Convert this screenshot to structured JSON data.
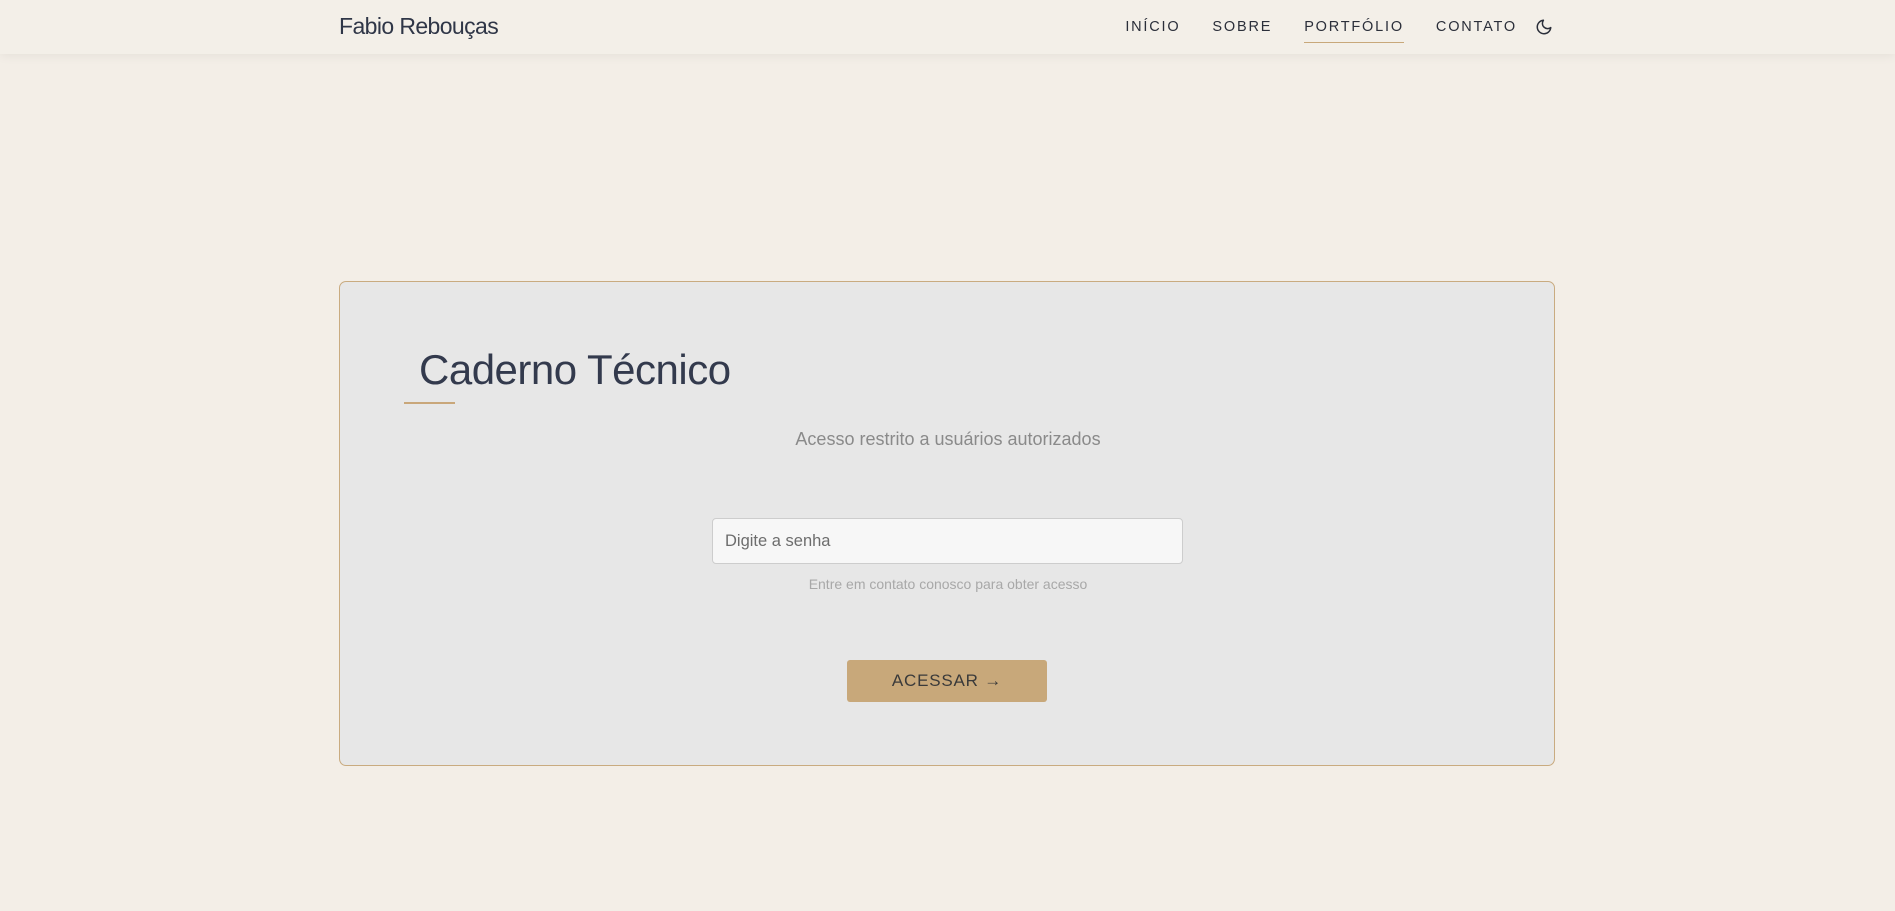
{
  "header": {
    "brand": "Fabio Rebouças",
    "nav": [
      {
        "label": "INÍCIO",
        "active": false
      },
      {
        "label": "SOBRE",
        "active": false
      },
      {
        "label": "PORTFÓLIO",
        "active": true
      },
      {
        "label": "CONTATO",
        "active": false
      }
    ],
    "theme_toggle_icon": "moon-icon"
  },
  "card": {
    "title": "Caderno Técnico",
    "subtitle": "Acesso restrito a usuários autorizados",
    "password": {
      "placeholder": "Digite a senha",
      "value": ""
    },
    "hint": "Entre em contato conosco para obter acesso",
    "button_label": "ACESSAR →"
  },
  "colors": {
    "background": "#f3eee7",
    "card_background": "#e7e7e7",
    "accent": "#c8a87a",
    "text_dark": "#333a4d",
    "text_muted": "#8a8a8a"
  }
}
